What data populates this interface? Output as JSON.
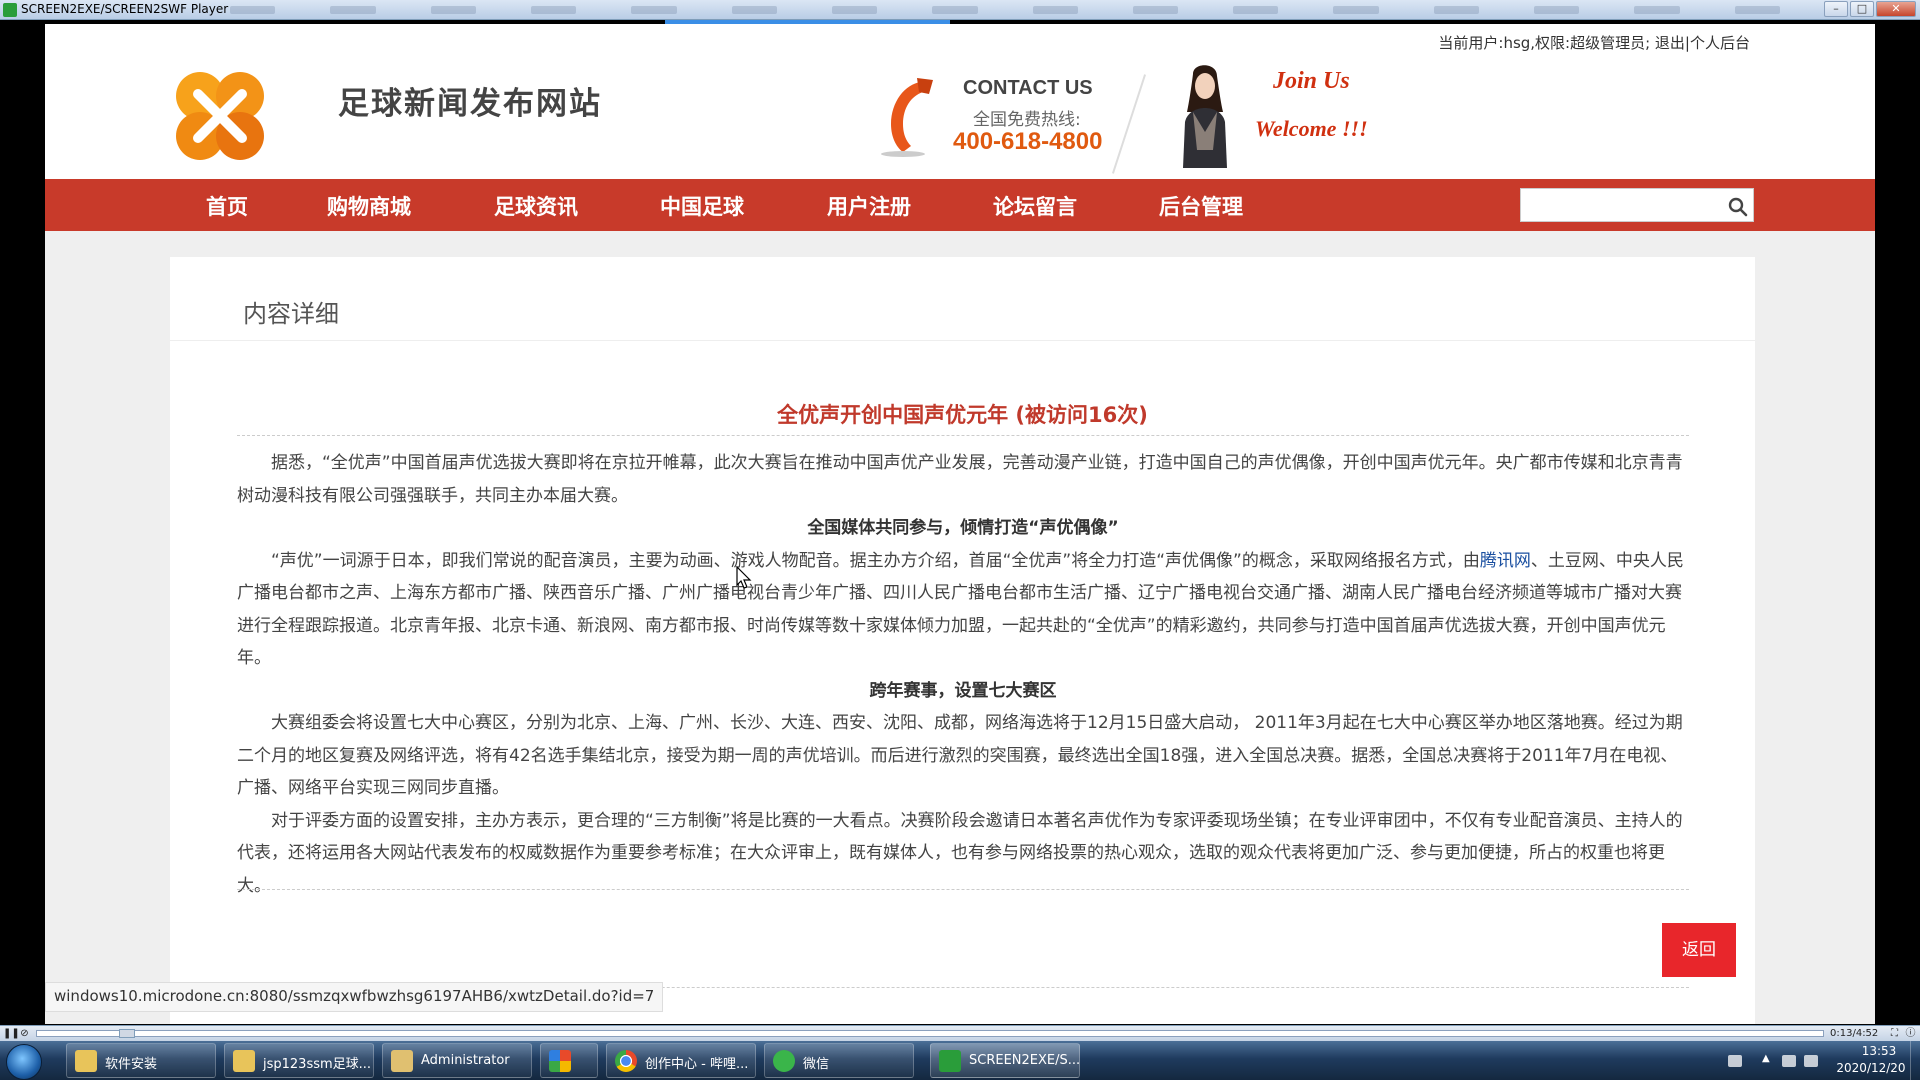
{
  "window": {
    "title": "SCREEN2EXE/SCREEN2SWF Player"
  },
  "site": {
    "user_bar": "当前用户:hsg,权限:超级管理员; 退出|个人后台",
    "title": "足球新闻发布网站",
    "contact": {
      "heading": "CONTACT US",
      "hotline_label": "全国免费热线:",
      "phone": "400-618-4800"
    },
    "join_us": "Join Us",
    "welcome": "Welcome !!!",
    "nav": [
      "首页",
      "购物商城",
      "足球资讯",
      "中国足球",
      "用户注册",
      "论坛留言",
      "后台管理"
    ],
    "search": {
      "placeholder": "",
      "value": ""
    },
    "colors": {
      "nav_bg": "#c83a2a",
      "title_red": "#c0392b",
      "button_red": "#e8262b",
      "phone_orange": "#e05a10"
    }
  },
  "panel": {
    "title": "内容详细"
  },
  "article": {
    "title": "全优声开创中国声优元年 (被访问16次)",
    "p1": "据悉，“全优声”中国首届声优选拔大赛即将在京拉开帷幕，此次大赛旨在推动中国声优产业发展，完善动漫产业链，打造中国自己的声优偶像，开创中国声优元年。央广都市传媒和北京青青树动漫科技有限公司强强联手，共同主办本届大赛。",
    "sub1": "全国媒体共同参与，倾情打造“声优偶像”",
    "p2_before": "“声优”一词源于日本，即我们常说的配音演员，主要为动画、游戏人物配音。据主办方介绍，首届“全优声”将全力打造“声优偶像”的概念，采取网络报名方式，由",
    "p2_link": "腾讯网",
    "p2_after": "、土豆网、中央人民广播电台都市之声、上海东方都市广播、陕西音乐广播、广州广播电视台青少年广播、四川人民广播电台都市生活广播、辽宁广播电视台交通广播、湖南人民广播电台经济频道等城市广播对大赛进行全程跟踪报道。北京青年报、北京卡通、新浪网、南方都市报、时尚传媒等数十家媒体倾力加盟，一起共赴的“全优声”的精彩邀约，共同参与打造中国首届声优选拔大赛，开创中国声优元年。",
    "sub2": "跨年赛事，设置七大赛区",
    "p3": "大赛组委会将设置七大中心赛区，分别为北京、上海、广州、长沙、大连、西安、沈阳、成都，网络海选将于12月15日盛大启动， 2011年3月起在七大中心赛区举办地区落地赛。经过为期二个月的地区复赛及网络评选，将有42名选手集结北京，接受为期一周的声优培训。而后进行激烈的突围赛，最终选出全国18强，进入全国总决赛。据悉，全国总决赛将于2011年7月在电视、广播、网络平台实现三网同步直播。",
    "p4": "对于评委方面的设置安排，主办方表示，更合理的“三方制衡”将是比赛的一大看点。决赛阶段会邀请日本著名声优作为专家评委现场坐镇；在专业评审团中，不仅有专业配音演员、主持人的代表，还将运用各大网站代表发布的权威数据作为重要参考标准；在大众评审上，既有媒体人，也有参与网络投票的热心观众，选取的观众代表将更加广泛、参与更加便捷，所占的权重也将更大。",
    "back_label": "返回"
  },
  "status_url": "windows10.microdone.cn:8080/ssmzqxwfbwzhsg6197AHB6/xwtzDetail.do?id=7",
  "player": {
    "time": "0:13/4:52"
  },
  "taskbar": {
    "items": [
      "软件安装",
      "jsp123ssm足球...",
      "Administrator",
      "",
      "创作中心 - 哔哩...",
      "微信",
      "SCREEN2EXE/S..."
    ],
    "clock_time": "13:53",
    "clock_date": "2020/12/20"
  }
}
